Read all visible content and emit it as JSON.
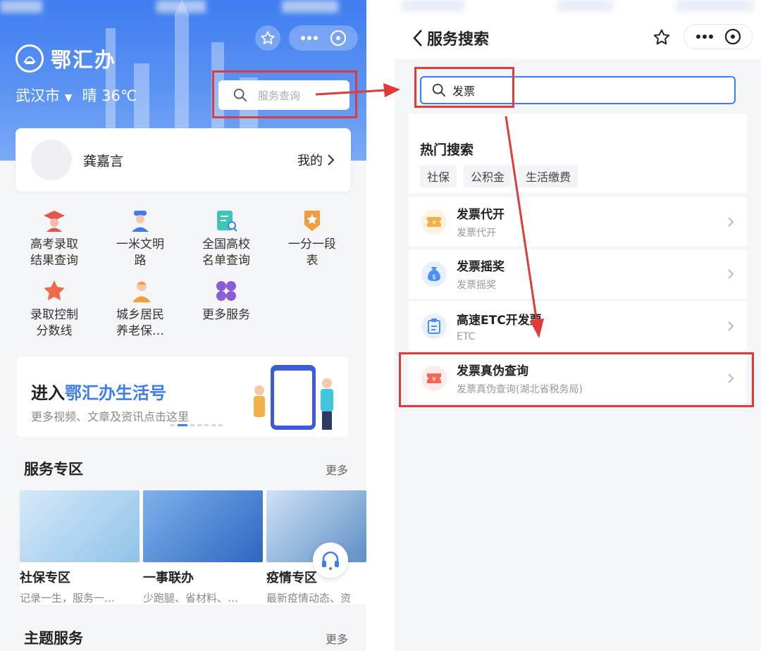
{
  "left": {
    "app_name": "鄂汇办",
    "city": "武汉市",
    "weather": "晴 36℃",
    "search_placeholder": "服务查询",
    "user": {
      "name": "龚嘉言",
      "mine_label": "我的"
    },
    "services": [
      {
        "label_1": "高考录取",
        "label_2": "结果查询",
        "icon": "graduate-icon"
      },
      {
        "label_1": "一米文明",
        "label_2": "路",
        "icon": "officer-icon"
      },
      {
        "label_1": "全国高校",
        "label_2": "名单查询",
        "icon": "document-search-icon"
      },
      {
        "label_1": "一分一段",
        "label_2": "表",
        "icon": "star-badge-icon"
      },
      {
        "label_1": "录取控制",
        "label_2": "分数线",
        "icon": "star-icon"
      },
      {
        "label_1": "城乡居民",
        "label_2": "养老保…",
        "icon": "elder-icon"
      },
      {
        "label_1": "更多服务",
        "label_2": "",
        "icon": "grid-icon"
      }
    ],
    "banner": {
      "title_prefix": "进入",
      "title_highlight": "鄂汇办生活号",
      "subtitle": "更多视频、文章及资讯点击这里"
    },
    "section_service": {
      "title": "服务专区",
      "more": "更多"
    },
    "cards": [
      {
        "title": "社保专区",
        "subtitle": "记录一生，服务一…"
      },
      {
        "title": "一事联办",
        "subtitle": "少跑腿、省材料、…"
      },
      {
        "title": "疫情专区",
        "subtitle": "最新疫情动态、资"
      }
    ],
    "section_theme": {
      "title": "主题服务",
      "more": "更多"
    }
  },
  "right": {
    "title": "服务搜索",
    "search_value": "发票",
    "hot": {
      "title": "热门搜索",
      "chips": [
        "社保",
        "公积金",
        "生活缴费"
      ]
    },
    "results": [
      {
        "title": "发票代开",
        "subtitle": "发票代开",
        "icon": "ticket-icon",
        "color": "#f2b24a"
      },
      {
        "title": "发票摇奖",
        "subtitle": "发票摇奖",
        "icon": "money-bag-icon",
        "color": "#4d8ef5"
      },
      {
        "title": "高速ETC开发票",
        "subtitle": "ETC",
        "icon": "clipboard-icon",
        "color": "#4d8ef5"
      },
      {
        "title": "发票真伪查询",
        "subtitle": "发票真伪查询(湖北省税务局)",
        "icon": "ticket-icon",
        "color": "#ef6a5a"
      }
    ]
  },
  "colors": {
    "primary": "#3d7cf0",
    "highlight": "#e03a3a"
  }
}
